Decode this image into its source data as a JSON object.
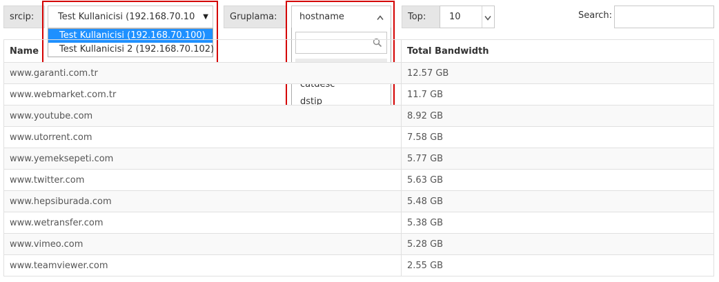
{
  "filters": {
    "srcip": {
      "label": "srcip:",
      "selected": "Test Kullanicisi (192.168.70.10",
      "options": [
        "Test Kullanicisi (192.168.70.100)",
        "Test Kullanicisi 2 (192.168.70.102)"
      ]
    },
    "grouping": {
      "label": "Gruplama:",
      "selected": "hostname",
      "search_placeholder": "",
      "options": [
        "hostname",
        "catdesc",
        "dstip"
      ]
    },
    "top": {
      "label": "Top:",
      "value": "10"
    },
    "search": {
      "label": "Search:",
      "placeholder": ""
    }
  },
  "table": {
    "headers": [
      "Name",
      "Total Bandwidth"
    ],
    "rows": [
      {
        "name": "www.garanti.com.tr",
        "bandwidth": "12.57 GB"
      },
      {
        "name": "www.webmarket.com.tr",
        "bandwidth": "11.7 GB"
      },
      {
        "name": "www.youtube.com",
        "bandwidth": "8.92 GB"
      },
      {
        "name": "www.utorrent.com",
        "bandwidth": "7.58 GB"
      },
      {
        "name": "www.yemeksepeti.com",
        "bandwidth": "5.77 GB"
      },
      {
        "name": "www.twitter.com",
        "bandwidth": "5.63 GB"
      },
      {
        "name": "www.hepsiburada.com",
        "bandwidth": "5.48 GB"
      },
      {
        "name": "www.wetransfer.com",
        "bandwidth": "5.38 GB"
      },
      {
        "name": "www.vimeo.com",
        "bandwidth": "5.28 GB"
      },
      {
        "name": "www.teamviewer.com",
        "bandwidth": "2.55 GB"
      }
    ]
  },
  "colors": {
    "highlight": "#d40000",
    "selected_option": "#1e90ff",
    "addon_bg": "#e6e6e6"
  }
}
